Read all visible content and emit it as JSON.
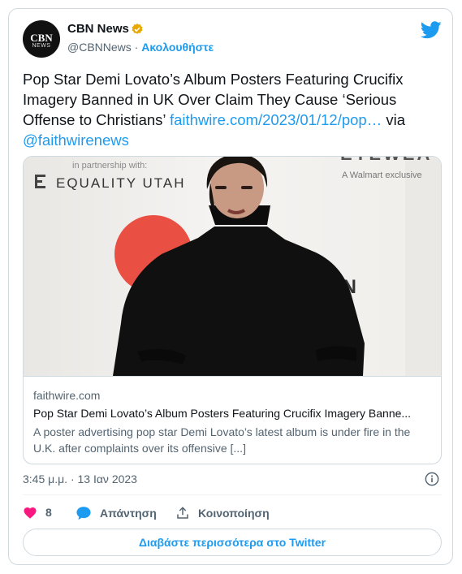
{
  "account": {
    "avatar_text": "CBN",
    "avatar_subtext": "NEWS",
    "name": "CBN News",
    "handle": "@CBNNews",
    "separator": "·",
    "follow_label": "Ακολουθήστε"
  },
  "tweet": {
    "text": "Pop Star Demi Lovato’s Album Posters Featuring Crucifix Imagery Banned in UK Over Claim They Cause ‘Serious Offense to Christians’ ",
    "link": "faithwire.com/2023/01/12/pop…",
    "via": " via ",
    "mention": "@faithwirenews"
  },
  "photo": {
    "backdrop_text_partnership": "in partnership with:",
    "backdrop_text_brand": "EQUALITY UTAH",
    "backdrop_text_walmart": "A Walmart exclusive",
    "backdrop_text_top": "EYEWEA",
    "backdrop_text_side": "ON"
  },
  "link_card": {
    "domain": "faithwire.com",
    "title": "Pop Star Demi Lovato’s Album Posters Featuring Crucifix Imagery Banne...",
    "description": "A poster advertising pop star Demi Lovato’s latest album is under fire in the U.K. after complaints over its offensive [...]"
  },
  "meta": {
    "timestamp": "3:45 μ.μ. · 13 Ιαν 2023"
  },
  "actions": {
    "like_count": "8",
    "reply_label": "Απάντηση",
    "share_label": "Κοινοποίηση"
  },
  "read_more_label": "Διαβάστε περισσότερα στο Twitter",
  "colors": {
    "accent": "#1d9bf0",
    "like": "#f91880",
    "secondary_text": "#536471"
  }
}
